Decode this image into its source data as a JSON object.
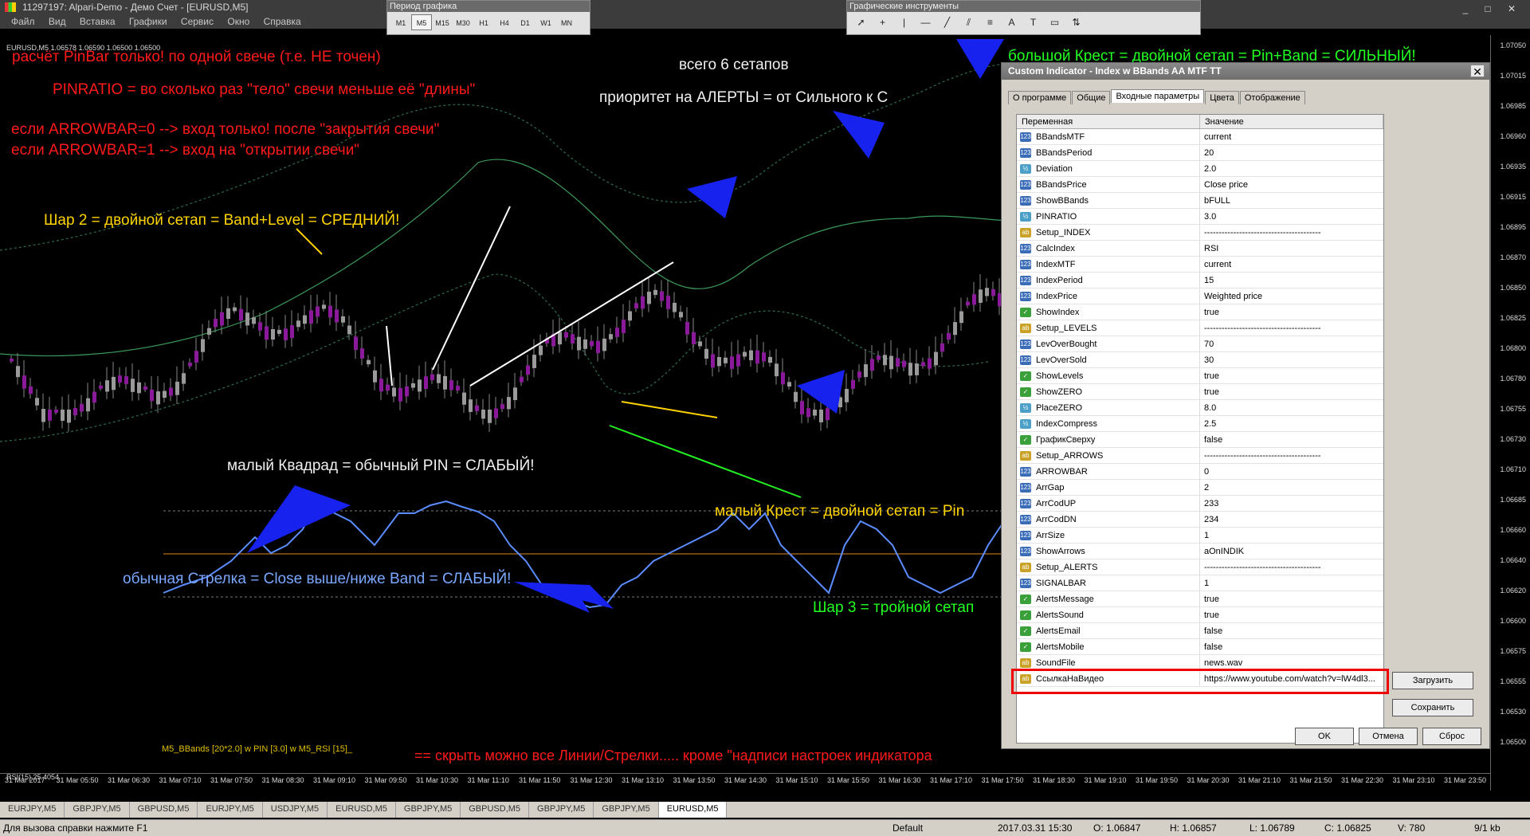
{
  "window": {
    "title": "11297197: Alpari-Demo - Демо Счет - [EURUSD,M5]"
  },
  "menu": [
    "Файл",
    "Вид",
    "Вставка",
    "Графики",
    "Сервис",
    "Окно",
    "Справка"
  ],
  "period_toolbar": {
    "title": "Период графика",
    "buttons": [
      "M1",
      "M5",
      "M15",
      "M30",
      "H1",
      "H4",
      "D1",
      "W1",
      "MN"
    ],
    "selected": "M5"
  },
  "draw_toolbar": {
    "title": "Графические инструменты",
    "tools": [
      "pointer-icon",
      "crosshair-icon",
      "vline-icon",
      "hline-icon",
      "trendline-icon",
      "channel-icon",
      "fibo-icon",
      "text-icon",
      "label-icon",
      "rectangle-icon",
      "arrow-icon"
    ]
  },
  "chart": {
    "symbol_info": "EURUSD,M5  1.06578 1.06590 1.06500 1.06500",
    "indicator_label": "M5_BBands [20*2.0] w PIN [3.0] w M5_RSI [15]_",
    "rsi_label": "RSI(15) 25.4054",
    "annotations": {
      "a1": "расчёт PinBar только! по одной свече (т.е. НЕ точен)",
      "a2": "PINRATIO = во сколько раз \"тело\" свечи меньше её \"длины\"",
      "a3": "если ARROWBAR=0 --> вход только! после \"закрытия свечи\"",
      "a4": "если ARROWBAR=1 --> вход на \"открытии свечи\"",
      "a5": "всего 6 сетапов",
      "a6": "приоритет на АЛЕРТЫ = от Сильного к С",
      "a7": "большой Крест = двойной сетап = Pin+Band = СИЛЬНЫЙ!",
      "a8": "Шар 2 = двойной сетап = Band+Level = СРЕДНИЙ!",
      "a9": "малый Квадрад = обычный PIN = СЛАБЫЙ!",
      "a10": "малый Крест = двойной сетап = Pin",
      "a11": "обычная Стрелка = Close выше/ниже Band = СЛАБЫЙ!",
      "a12": "Шар 3 = тройной сетап",
      "a13": "== скрыть можно все Линии/Стрелки.....  кроме \"надписи настроек индикатора"
    }
  },
  "price_scale": [
    "1.07050",
    "1.07015",
    "1.06985",
    "1.06960",
    "1.06935",
    "1.06915",
    "1.06895",
    "1.06870",
    "1.06850",
    "1.06825",
    "1.06800",
    "1.06780",
    "1.06755",
    "1.06730",
    "1.06710",
    "1.06685",
    "1.06660",
    "1.06640",
    "1.06620",
    "1.06600",
    "1.06575",
    "1.06555",
    "1.06530",
    "1.06500"
  ],
  "time_axis": [
    "31 Mar 2017",
    "31 Mar 05:50",
    "31 Mar 06:30",
    "31 Mar 07:10",
    "31 Mar 07:50",
    "31 Mar 08:30",
    "31 Mar 09:10",
    "31 Mar 09:50",
    "31 Mar 10:30",
    "31 Mar 11:10",
    "31 Mar 11:50",
    "31 Mar 12:30",
    "31 Mar 13:10",
    "31 Mar 13:50",
    "31 Mar 14:30",
    "31 Mar 15:10",
    "31 Mar 15:50",
    "31 Mar 16:30",
    "31 Mar 17:10",
    "31 Mar 17:50",
    "31 Mar 18:30",
    "31 Mar 19:10",
    "31 Mar 19:50",
    "31 Mar 20:30",
    "31 Mar 21:10",
    "31 Mar 21:50",
    "31 Mar 22:30",
    "31 Mar 23:10",
    "31 Mar 23:50"
  ],
  "chart_tabs": [
    "EURJPY,M5",
    "GBPJPY,M5",
    "GBPUSD,M5",
    "EURJPY,M5",
    "USDJPY,M5",
    "EURUSD,M5",
    "GBPJPY,M5",
    "GBPUSD,M5",
    "GBPJPY,M5",
    "GBPJPY,M5",
    "EURUSD,M5"
  ],
  "active_tab": "EURUSD,M5",
  "status": {
    "help": "Для вызова справки нажмите F1",
    "profile": "Default",
    "datetime": "2017.03.31 15:30",
    "open": "O: 1.06847",
    "high": "H: 1.06857",
    "low": "L: 1.06789",
    "close": "C: 1.06825",
    "volume": "V: 780",
    "traffic": "9/1 kb"
  },
  "dialog": {
    "title": "Custom Indicator - Index w BBands AA MTF TT",
    "tabs": [
      "О программе",
      "Общие",
      "Входные параметры",
      "Цвета",
      "Отображение"
    ],
    "active_tab": "Входные параметры",
    "col_var": "Переменная",
    "col_val": "Значение",
    "params": [
      {
        "t": "123",
        "n": "BBandsMTF",
        "v": "current"
      },
      {
        "t": "123",
        "n": "BBandsPeriod",
        "v": "20"
      },
      {
        "t": "dbl",
        "n": "Deviation",
        "v": "2.0"
      },
      {
        "t": "123",
        "n": "BBandsPrice",
        "v": "Close price"
      },
      {
        "t": "123",
        "n": "ShowBBands",
        "v": "bFULL"
      },
      {
        "t": "dbl",
        "n": "PINRATIO",
        "v": "3.0"
      },
      {
        "t": "ab",
        "n": "Setup_INDEX",
        "v": "----------------------------------------"
      },
      {
        "t": "123",
        "n": "CalcIndex",
        "v": "RSI"
      },
      {
        "t": "123",
        "n": "IndexMTF",
        "v": "current"
      },
      {
        "t": "123",
        "n": "IndexPeriod",
        "v": "15"
      },
      {
        "t": "123",
        "n": "IndexPrice",
        "v": "Weighted price"
      },
      {
        "t": "bool",
        "n": "ShowIndex",
        "v": "true"
      },
      {
        "t": "ab",
        "n": "Setup_LEVELS",
        "v": "----------------------------------------"
      },
      {
        "t": "123",
        "n": "LevOverBought",
        "v": "70"
      },
      {
        "t": "123",
        "n": "LevOverSold",
        "v": "30"
      },
      {
        "t": "bool",
        "n": "ShowLevels",
        "v": "true"
      },
      {
        "t": "bool",
        "n": "ShowZERO",
        "v": "true"
      },
      {
        "t": "dbl",
        "n": "PlaceZERO",
        "v": "8.0"
      },
      {
        "t": "dbl",
        "n": "IndexCompress",
        "v": "2.5"
      },
      {
        "t": "bool",
        "n": "ГрафикСверху",
        "v": "false"
      },
      {
        "t": "ab",
        "n": "Setup_ARROWS",
        "v": "----------------------------------------"
      },
      {
        "t": "123",
        "n": "ARROWBAR",
        "v": "0"
      },
      {
        "t": "123",
        "n": "ArrGap",
        "v": "2"
      },
      {
        "t": "123",
        "n": "ArrCodUP",
        "v": "233"
      },
      {
        "t": "123",
        "n": "ArrCodDN",
        "v": "234"
      },
      {
        "t": "123",
        "n": "ArrSize",
        "v": "1"
      },
      {
        "t": "123",
        "n": "ShowArrows",
        "v": "aOnINDIK"
      },
      {
        "t": "ab",
        "n": "Setup_ALERTS",
        "v": "----------------------------------------"
      },
      {
        "t": "123",
        "n": "SIGNALBAR",
        "v": "1"
      },
      {
        "t": "bool",
        "n": "AlertsMessage",
        "v": "true"
      },
      {
        "t": "bool",
        "n": "AlertsSound",
        "v": "true"
      },
      {
        "t": "bool",
        "n": "AlertsEmail",
        "v": "false"
      },
      {
        "t": "bool",
        "n": "AlertsMobile",
        "v": "false"
      },
      {
        "t": "ab",
        "n": "SoundFile",
        "v": "news.wav"
      },
      {
        "t": "ab",
        "n": "СсылкаНаВидео",
        "v": "https://www.youtube.com/watch?v=lW4dl3..."
      }
    ],
    "btn_load": "Загрузить",
    "btn_save": "Сохранить",
    "btn_ok": "OK",
    "btn_cancel": "Отмена",
    "btn_reset": "Сброс"
  }
}
